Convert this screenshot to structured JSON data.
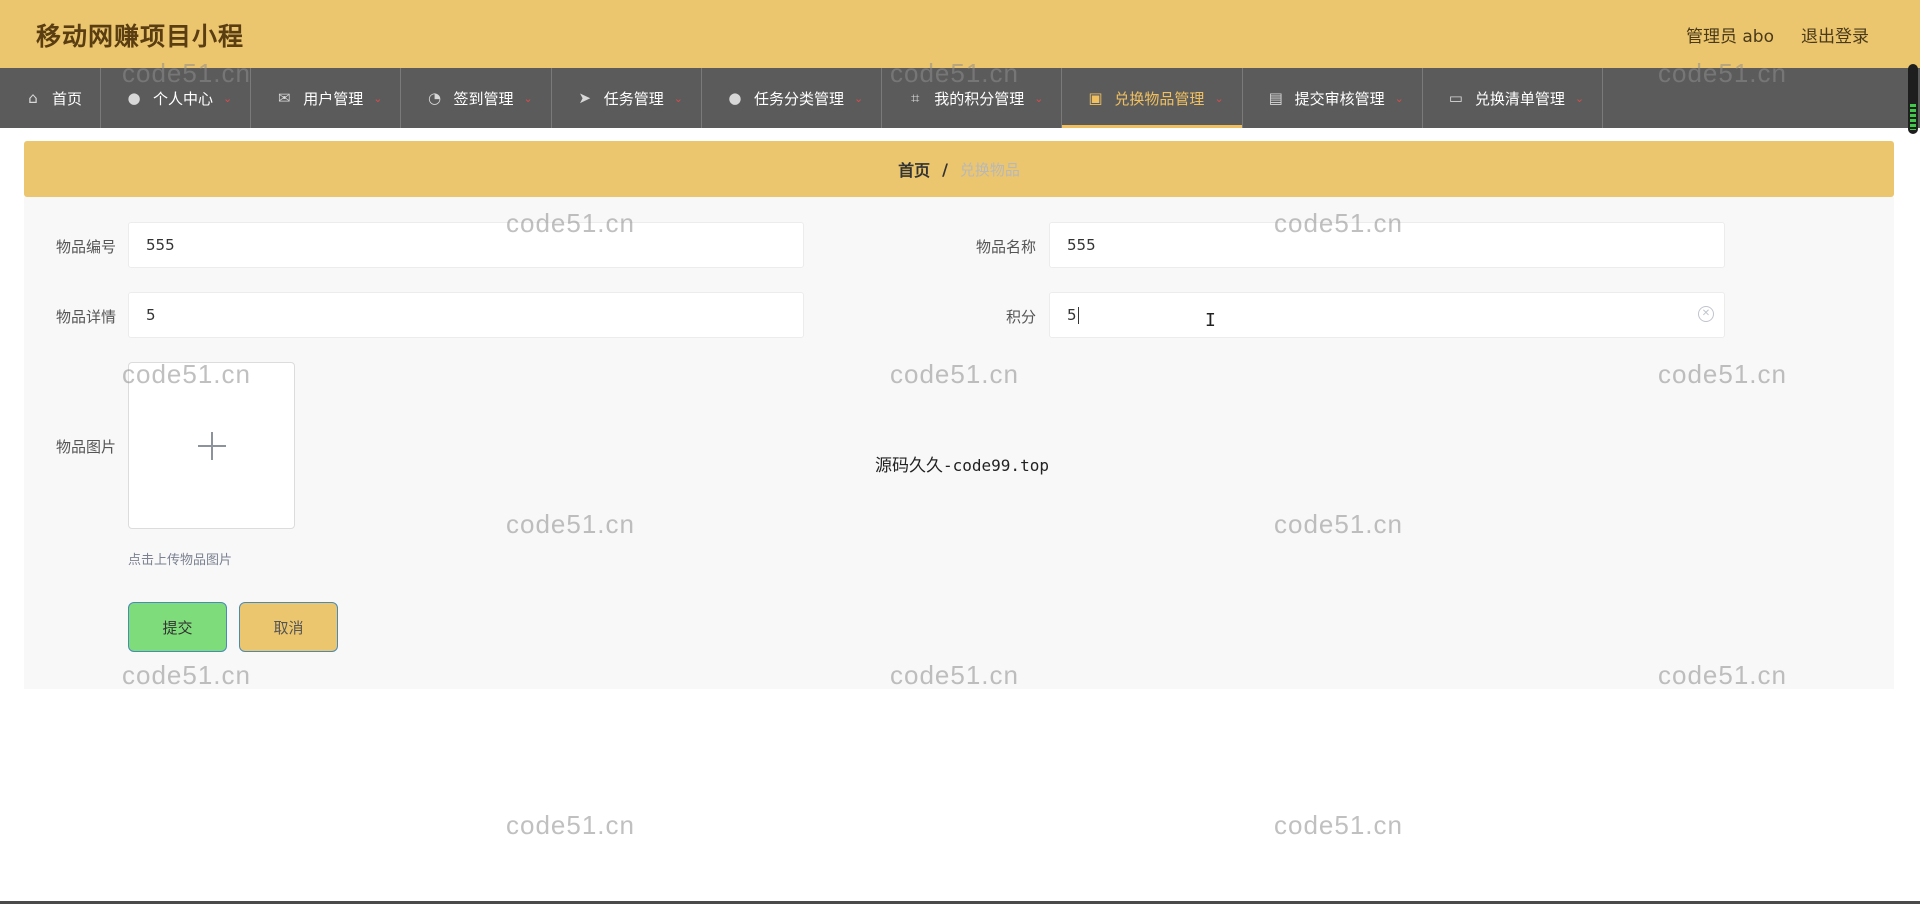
{
  "app": {
    "title": "移动网赚项目小程"
  },
  "header": {
    "user_label": "管理员 abo",
    "logout_label": "退出登录"
  },
  "nav": {
    "items": [
      {
        "label": "首页",
        "icon": "home-icon",
        "glyph": "⌂",
        "dropdown": false,
        "active": false
      },
      {
        "label": "个人中心",
        "icon": "user-icon",
        "glyph": "👤",
        "dropdown": true,
        "active": false
      },
      {
        "label": "用户管理",
        "icon": "mail-icon",
        "glyph": "✉",
        "dropdown": true,
        "active": false
      },
      {
        "label": "签到管理",
        "icon": "compass-icon",
        "glyph": "◔",
        "dropdown": true,
        "active": false
      },
      {
        "label": "任务管理",
        "icon": "send-icon",
        "glyph": "➤",
        "dropdown": true,
        "active": false
      },
      {
        "label": "任务分类管理",
        "icon": "user-icon",
        "glyph": "👤",
        "dropdown": true,
        "active": false
      },
      {
        "label": "我的积分管理",
        "icon": "crop-icon",
        "glyph": "⌗",
        "dropdown": true,
        "active": false
      },
      {
        "label": "兑换物品管理",
        "icon": "briefcase-icon",
        "glyph": "▣",
        "dropdown": true,
        "active": true
      },
      {
        "label": "提交审核管理",
        "icon": "clipboard-icon",
        "glyph": "▤",
        "dropdown": true,
        "active": false
      },
      {
        "label": "兑换清单管理",
        "icon": "monitor-icon",
        "glyph": "▭",
        "dropdown": true,
        "active": false
      }
    ]
  },
  "breadcrumb": {
    "home": "首页",
    "separator": "/",
    "current": "兑换物品"
  },
  "form": {
    "item_code": {
      "label": "物品编号",
      "value": "555"
    },
    "item_name": {
      "label": "物品名称",
      "value": "555"
    },
    "item_detail": {
      "label": "物品详情",
      "value": "5"
    },
    "points": {
      "label": "积分",
      "value": "5"
    },
    "item_image": {
      "label": "物品图片",
      "hint": "点击上传物品图片"
    },
    "submit_label": "提交",
    "cancel_label": "取消"
  },
  "overlay_text": {
    "cjk": "源码久久",
    "latin": "-code99.top"
  },
  "watermark": "code51.cn",
  "colors": {
    "header": "#ebc66e",
    "nav": "#5b5b5b",
    "active": "#f0c060",
    "submit": "#7fdc7a"
  }
}
